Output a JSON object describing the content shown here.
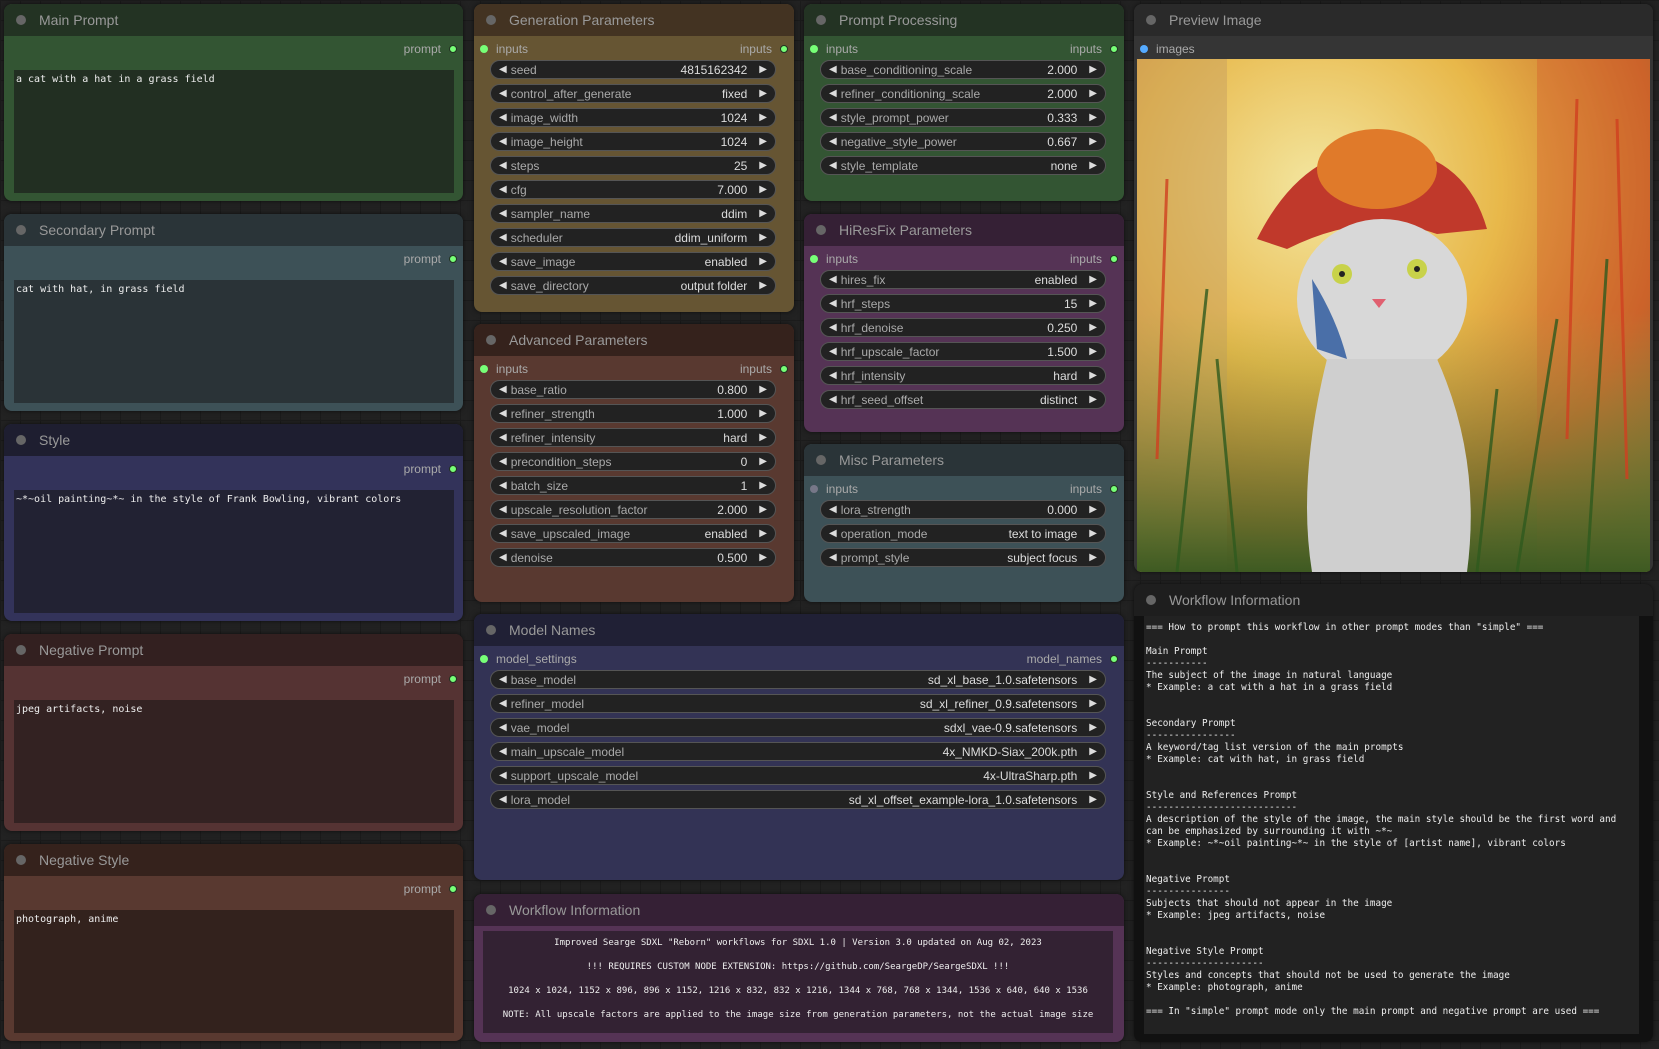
{
  "colors": {
    "accent_slot": "#77ff77",
    "image_slot": "#55aaff"
  },
  "main_prompt": {
    "title": "Main Prompt",
    "output": "prompt",
    "text": "a cat with a hat in a grass field"
  },
  "secondary_prompt": {
    "title": "Secondary Prompt",
    "output": "prompt",
    "text": "cat with hat, in grass field"
  },
  "style": {
    "title": "Style",
    "output": "prompt",
    "text": "~*~oil painting~*~ in the style of Frank Bowling, vibrant colors"
  },
  "negative_prompt": {
    "title": "Negative Prompt",
    "output": "prompt",
    "text": "jpeg artifacts, noise"
  },
  "negative_style": {
    "title": "Negative Style",
    "output": "prompt",
    "text": "photograph, anime"
  },
  "generation": {
    "title": "Generation Parameters",
    "input": "inputs",
    "output": "inputs",
    "widgets": [
      {
        "name": "seed",
        "value": "4815162342"
      },
      {
        "name": "control_after_generate",
        "value": "fixed"
      },
      {
        "name": "image_width",
        "value": "1024"
      },
      {
        "name": "image_height",
        "value": "1024"
      },
      {
        "name": "steps",
        "value": "25"
      },
      {
        "name": "cfg",
        "value": "7.000"
      },
      {
        "name": "sampler_name",
        "value": "ddim"
      },
      {
        "name": "scheduler",
        "value": "ddim_uniform"
      },
      {
        "name": "save_image",
        "value": "enabled"
      },
      {
        "name": "save_directory",
        "value": "output folder"
      }
    ]
  },
  "advanced": {
    "title": "Advanced Parameters",
    "input": "inputs",
    "output": "inputs",
    "widgets": [
      {
        "name": "base_ratio",
        "value": "0.800"
      },
      {
        "name": "refiner_strength",
        "value": "1.000"
      },
      {
        "name": "refiner_intensity",
        "value": "hard"
      },
      {
        "name": "precondition_steps",
        "value": "0"
      },
      {
        "name": "batch_size",
        "value": "1"
      },
      {
        "name": "upscale_resolution_factor",
        "value": "2.000"
      },
      {
        "name": "save_upscaled_image",
        "value": "enabled"
      },
      {
        "name": "denoise",
        "value": "0.500"
      }
    ]
  },
  "model_names": {
    "title": "Model Names",
    "input": "model_settings",
    "output": "model_names",
    "widgets": [
      {
        "name": "base_model",
        "value": "sd_xl_base_1.0.safetensors"
      },
      {
        "name": "refiner_model",
        "value": "sd_xl_refiner_0.9.safetensors"
      },
      {
        "name": "vae_model",
        "value": "sdxl_vae-0.9.safetensors"
      },
      {
        "name": "main_upscale_model",
        "value": "4x_NMKD-Siax_200k.pth"
      },
      {
        "name": "support_upscale_model",
        "value": "4x-UltraSharp.pth"
      },
      {
        "name": "lora_model",
        "value": "sd_xl_offset_example-lora_1.0.safetensors"
      }
    ]
  },
  "prompt_processing": {
    "title": "Prompt Processing",
    "input": "inputs",
    "output": "inputs",
    "widgets": [
      {
        "name": "base_conditioning_scale",
        "value": "2.000"
      },
      {
        "name": "refiner_conditioning_scale",
        "value": "2.000"
      },
      {
        "name": "style_prompt_power",
        "value": "0.333"
      },
      {
        "name": "negative_style_power",
        "value": "0.667"
      },
      {
        "name": "style_template",
        "value": "none"
      }
    ]
  },
  "hiresfix": {
    "title": "HiResFix Parameters",
    "input": "inputs",
    "output": "inputs",
    "widgets": [
      {
        "name": "hires_fix",
        "value": "enabled"
      },
      {
        "name": "hrf_steps",
        "value": "15"
      },
      {
        "name": "hrf_denoise",
        "value": "0.250"
      },
      {
        "name": "hrf_upscale_factor",
        "value": "1.500"
      },
      {
        "name": "hrf_intensity",
        "value": "hard"
      },
      {
        "name": "hrf_seed_offset",
        "value": "distinct"
      }
    ]
  },
  "misc": {
    "title": "Misc Parameters",
    "input": "inputs",
    "output": "inputs",
    "widgets": [
      {
        "name": "lora_strength",
        "value": "0.000"
      },
      {
        "name": "operation_mode",
        "value": "text to image"
      },
      {
        "name": "prompt_style",
        "value": "subject focus"
      }
    ]
  },
  "preview": {
    "title": "Preview Image",
    "input": "images"
  },
  "workflow_center": {
    "title": "Workflow Information",
    "lines": [
      "Improved Searge SDXL \"Reborn\" workflows for SDXL 1.0   |   Version 3.0 updated on Aug 02, 2023",
      "!!! REQUIRES CUSTOM NODE EXTENSION: https://github.com/SeargeDP/SeargeSDXL !!!",
      "1024 x 1024, 1152 x 896, 896 x 1152, 1216 x 832, 832 x 1216, 1344 x 768, 768 x 1344, 1536 x 640, 640 x 1536",
      "NOTE: All upscale factors are applied to the image size from generation parameters, not the actual image size"
    ]
  },
  "workflow_right": {
    "title": "Workflow Information",
    "text": "=== How to prompt this workflow in other prompt modes than \"simple\" ===\n\nMain Prompt\n-----------\nThe subject of the image in natural language\n* Example: a cat with a hat in a grass field\n\n\nSecondary Prompt\n----------------\nA keyword/tag list version of the main prompts\n* Example: cat with hat, in grass field\n\n\nStyle and References Prompt\n---------------------------\nA description of the style of the image, the main style should be the first word and can be emphasized by surrounding it with ~*~\n* Example: ~*~oil painting~*~ in the style of [artist name], vibrant colors\n\n\nNegative Prompt\n---------------\nSubjects that should not appear in the image\n* Example: jpeg artifacts, noise\n\n\nNegative Style Prompt\n---------------------\nStyles and concepts that should not be used to generate the image\n* Example: photograph, anime\n\n=== In \"simple\" prompt mode only the main prompt and negative prompt are used ==="
  }
}
